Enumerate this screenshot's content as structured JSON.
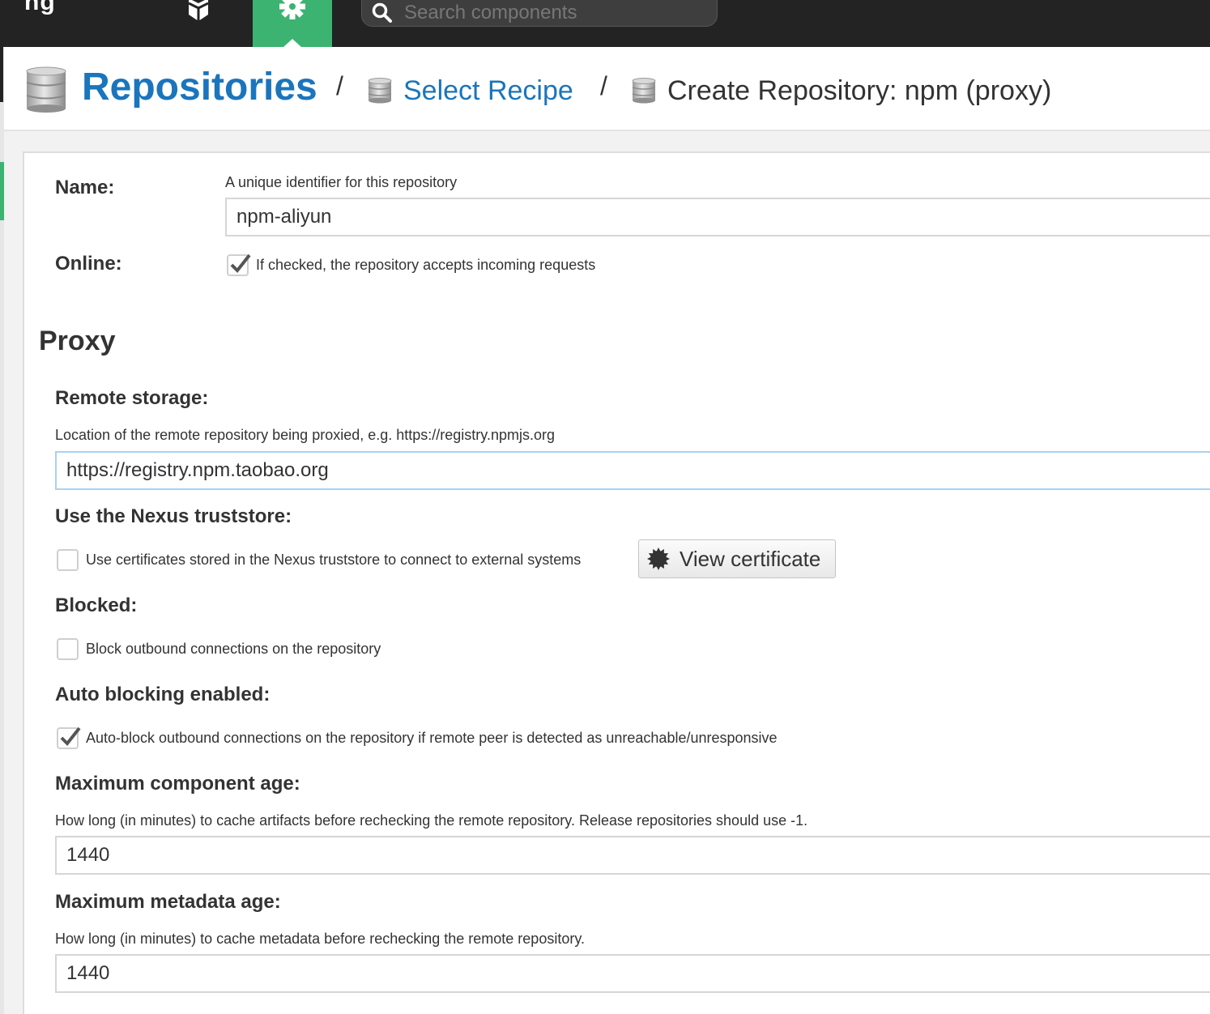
{
  "topbar": {
    "logo_fragment": "ng",
    "browse_icon": "cube-icon",
    "admin_icon": "gear-icon",
    "search": {
      "placeholder": "Search components",
      "icon": "search-icon"
    }
  },
  "breadcrumb": {
    "root_label": "Repositories",
    "separator": "/",
    "second_label": "Select Recipe",
    "current_label": "Create Repository: npm (proxy)",
    "icon": "database-icon"
  },
  "form": {
    "name": {
      "label": "Name:",
      "help": "A unique identifier for this repository",
      "value": "npm-aliyun"
    },
    "online": {
      "label": "Online:",
      "checked": true,
      "help": "If checked, the repository accepts incoming requests"
    },
    "proxy_section": {
      "title": "Proxy"
    },
    "remote_storage": {
      "label": "Remote storage:",
      "help": "Location of the remote repository being proxied, e.g. https://registry.npmjs.org",
      "value": "https://registry.npm.taobao.org"
    },
    "truststore": {
      "label": "Use the Nexus truststore:",
      "checked": false,
      "help": "Use certificates stored in the Nexus truststore to connect to external systems",
      "button_label": "View certificate",
      "button_icon": "certificate-icon"
    },
    "blocked": {
      "label": "Blocked:",
      "checked": false,
      "help": "Block outbound connections on the repository"
    },
    "auto_blocking": {
      "label": "Auto blocking enabled:",
      "checked": true,
      "help": "Auto-block outbound connections on the repository if remote peer is detected as unreachable/unresponsive"
    },
    "max_component_age": {
      "label": "Maximum component age:",
      "help": "How long (in minutes) to cache artifacts before rechecking the remote repository. Release repositories should use -1.",
      "value": "1440"
    },
    "max_metadata_age": {
      "label": "Maximum metadata age:",
      "help": "How long (in minutes) to cache metadata before rechecking the remote repository.",
      "value": "1440"
    }
  },
  "colors": {
    "topbar": "#232323",
    "accent_green": "#3cb371",
    "link_blue": "#1b75bc"
  }
}
